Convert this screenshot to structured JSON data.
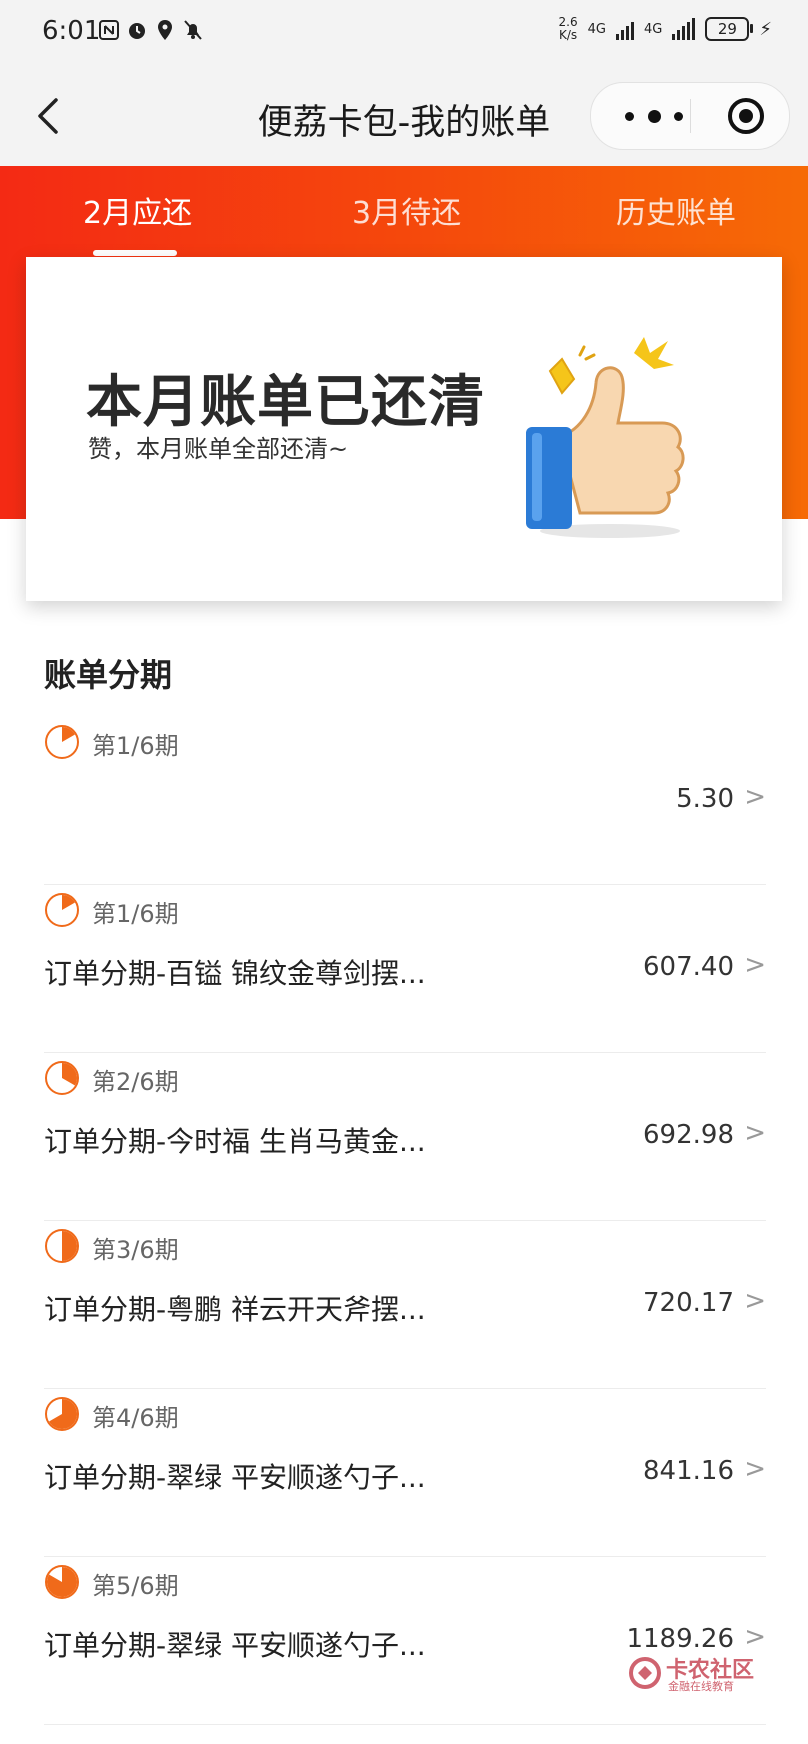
{
  "status_bar": {
    "time": "6:01",
    "speed_top": "2.6",
    "speed_bottom": "K/s",
    "net1": "4G",
    "net2": "4G",
    "battery": "29"
  },
  "nav": {
    "title": "便荔卡包-我的账单"
  },
  "tabs": [
    {
      "label": "2月应还",
      "active": true
    },
    {
      "label": "3月待还",
      "active": false
    },
    {
      "label": "历史账单",
      "active": false
    }
  ],
  "card": {
    "title": "本月账单已还清",
    "subtitle": "赞，本月账单全部还清~"
  },
  "section": {
    "title": "账单分期"
  },
  "installments": [
    {
      "period": "第1/6期",
      "desc": "",
      "amount": "5.30",
      "progress": 0.1667
    },
    {
      "period": "第1/6期",
      "desc": "订单分期-百镒 锦纹金尊剑摆...",
      "amount": "607.40",
      "progress": 0.1667
    },
    {
      "period": "第2/6期",
      "desc": "订单分期-今时福 生肖马黄金...",
      "amount": "692.98",
      "progress": 0.3333
    },
    {
      "period": "第3/6期",
      "desc": "订单分期-粤鹏 祥云开天斧摆...",
      "amount": "720.17",
      "progress": 0.5
    },
    {
      "period": "第4/6期",
      "desc": "订单分期-翠绿 平安顺遂勺子...",
      "amount": "841.16",
      "progress": 0.6667
    },
    {
      "period": "第5/6期",
      "desc": "订单分期-翠绿 平安顺遂勺子...",
      "amount": "1189.26",
      "progress": 0.8333
    }
  ],
  "watermark": {
    "main": "卡农社区",
    "sub": "金融在线教育"
  },
  "colors": {
    "accent": "#f06a1a",
    "header_start": "#f42a14",
    "header_end": "#f66a06"
  },
  "chevron": ">"
}
